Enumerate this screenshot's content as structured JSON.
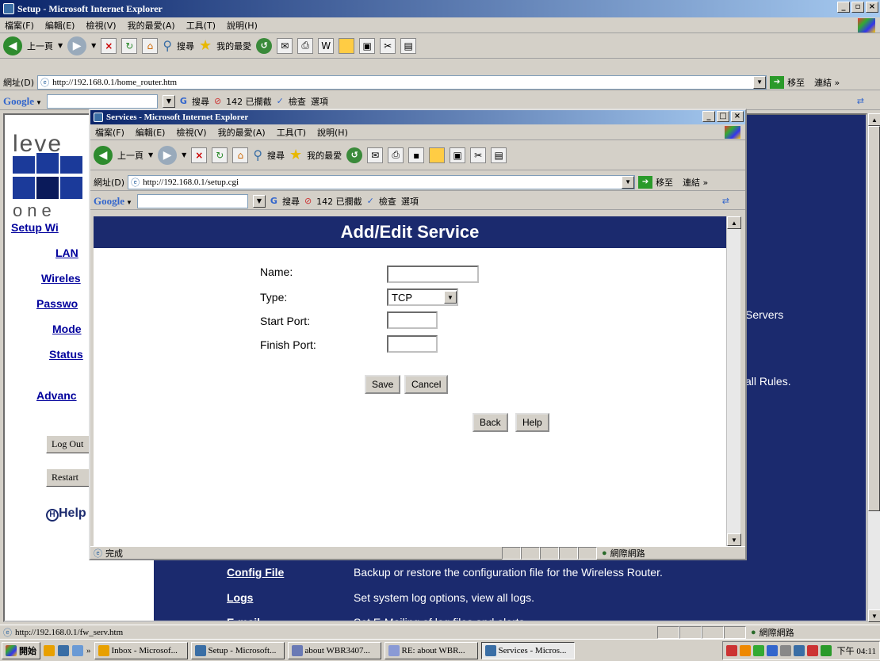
{
  "outer_window": {
    "title": "Setup - Microsoft Internet Explorer",
    "menu": [
      "檔案(F)",
      "編輯(E)",
      "檢視(V)",
      "我的最愛(A)",
      "工具(T)",
      "說明(H)"
    ],
    "toolbar": {
      "back_label": "上一頁",
      "search_label": "搜尋",
      "favorites_label": "我的最愛"
    },
    "address_label": "網址(D)",
    "address_value": "http://192.168.0.1/home_router.htm",
    "go_label": "移至",
    "links_label": "連結 »",
    "google_label": "Google",
    "google_search_label": "搜尋",
    "google_blocked_label": "142 已攔截",
    "google_check_label": "檢查",
    "google_options_label": "選項",
    "status_url": "http://192.168.0.1/fw_serv.htm",
    "status_zone": "網際網路"
  },
  "outer_page": {
    "logo_top": "leve",
    "logo_bottom": "one",
    "nav": [
      "Setup Wi",
      "LAN",
      "Wireles",
      "Passwo",
      "Mode",
      "Status",
      "Advanc"
    ],
    "logout_label": "Log Out",
    "restart_label": "Restart",
    "help_label": "Help",
    "right_text_1": "Servers",
    "right_text_2": "all Rules.",
    "rows": [
      {
        "link": "Config File",
        "desc": "Backup or restore the configuration file for the Wireless Router."
      },
      {
        "link": "Logs",
        "desc": "Set system log options, view all logs."
      },
      {
        "link": "E-mail",
        "desc": "Set E-Mailing of log files and alerts."
      }
    ]
  },
  "inner_window": {
    "title": "Services - Microsoft Internet Explorer",
    "address_value": "http://192.168.0.1/setup.cgi",
    "status_text": "完成",
    "status_zone": "網際網路"
  },
  "dialog": {
    "heading": "Add/Edit Service",
    "name_label": "Name:",
    "name_value": "",
    "type_label": "Type:",
    "type_value": "TCP",
    "start_port_label": "Start Port:",
    "start_port_value": "",
    "finish_port_label": "Finish Port:",
    "finish_port_value": "",
    "save_label": "Save",
    "cancel_label": "Cancel",
    "back_label": "Back",
    "help_label": "Help"
  },
  "taskbar": {
    "start_label": "開始",
    "tasks": [
      "Inbox - Microsof...",
      "Setup - Microsoft...",
      "about WBR3407...",
      "RE: about WBR...",
      "Services - Micros..."
    ],
    "active_task_index": 4,
    "clock": "下午 04:11"
  },
  "colors": {
    "page_navy": "#1b2a6e",
    "link_blue": "#00009c"
  }
}
